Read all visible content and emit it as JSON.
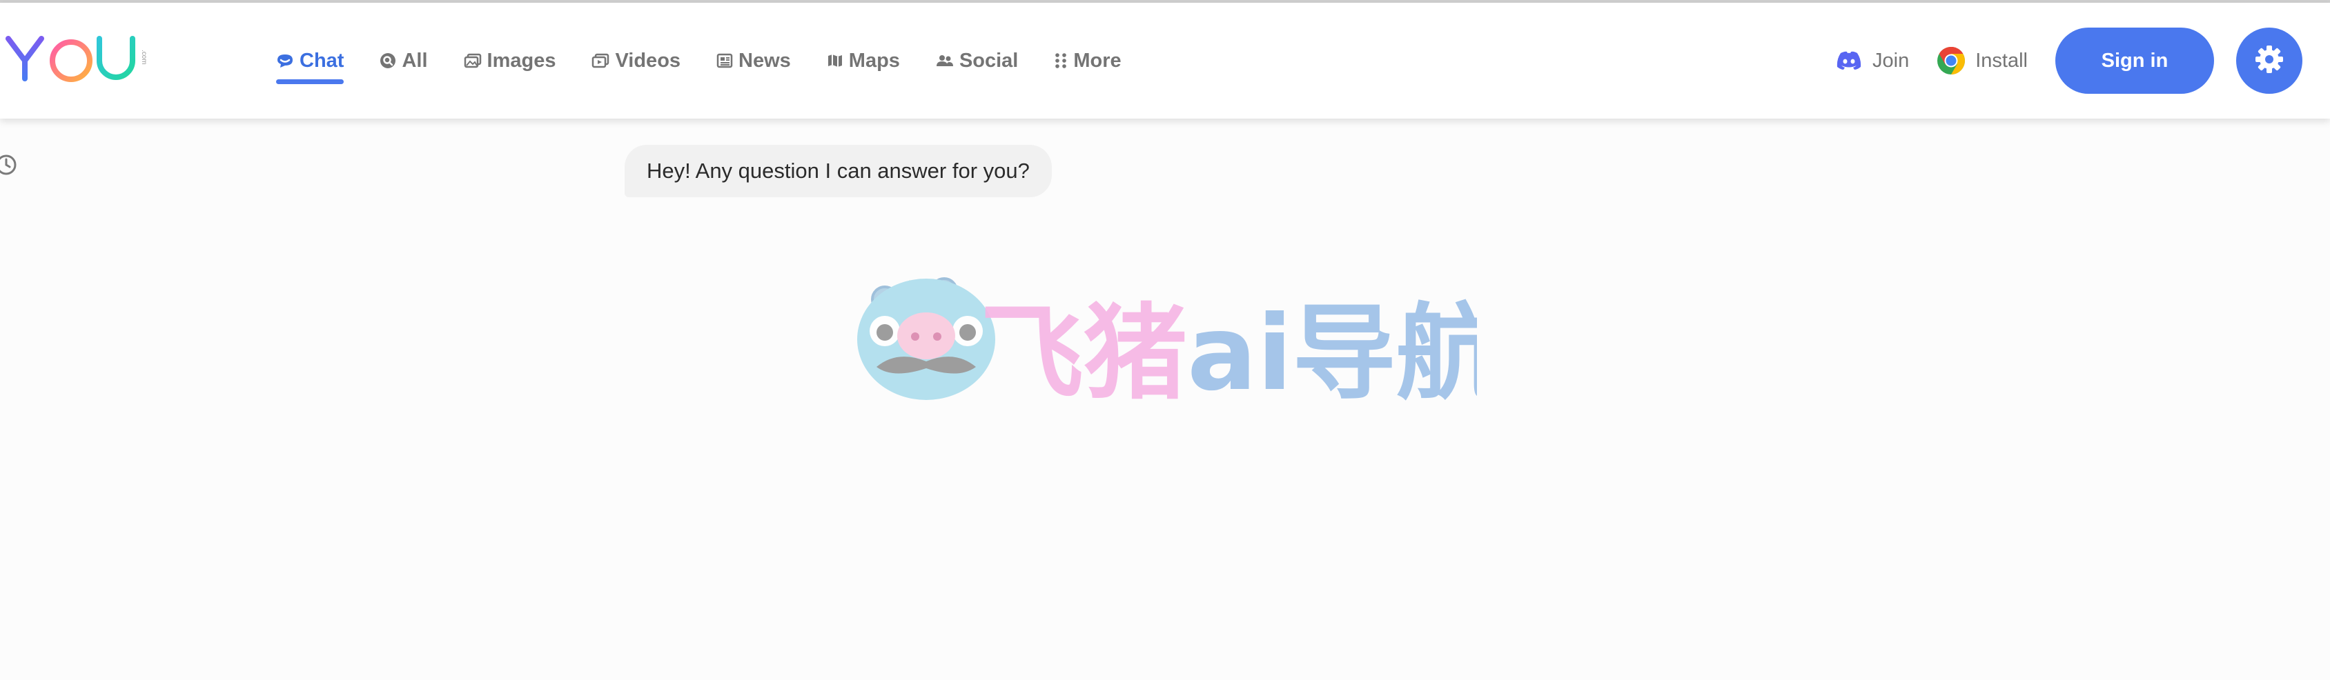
{
  "brand": {
    "logo_text": "YOU",
    "logo_suffix": ".com"
  },
  "nav": [
    {
      "label": "Chat",
      "icon": "chat-icon",
      "active": true
    },
    {
      "label": "All",
      "icon": "search-icon",
      "active": false
    },
    {
      "label": "Images",
      "icon": "images-icon",
      "active": false
    },
    {
      "label": "Videos",
      "icon": "videos-icon",
      "active": false
    },
    {
      "label": "News",
      "icon": "news-icon",
      "active": false
    },
    {
      "label": "Maps",
      "icon": "map-icon",
      "active": false
    },
    {
      "label": "Social",
      "icon": "people-icon",
      "active": false
    },
    {
      "label": "More",
      "icon": "dots-grid-icon",
      "active": false
    }
  ],
  "header_right": {
    "join_label": "Join",
    "join_icon": "discord-icon",
    "install_label": "Install",
    "install_icon": "chrome-icon",
    "signin_label": "Sign in",
    "settings_icon": "gear-icon"
  },
  "chat": {
    "greeting": "Hey! Any question I can answer for you?"
  },
  "watermark": {
    "text": "飞猪ai导航"
  },
  "colors": {
    "accent": "#4a78ee",
    "nav_text": "#747474",
    "bubble_bg": "#f1f1f1",
    "discord": "#5865f2"
  }
}
